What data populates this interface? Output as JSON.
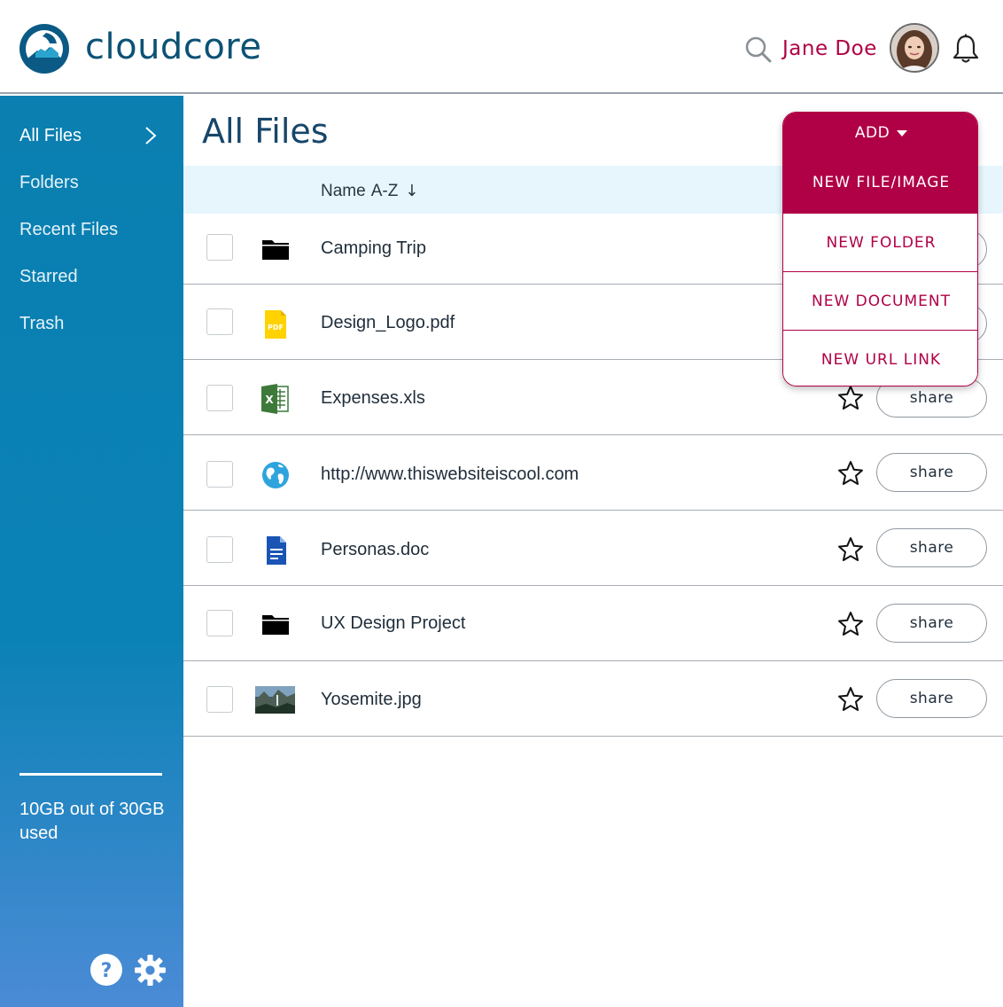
{
  "brand": {
    "name": "cloudcore",
    "logo_icon": "cloudcore-logo-icon"
  },
  "header": {
    "user_name": "Jane Doe",
    "accent_color": "#b00046"
  },
  "sidebar": {
    "items": [
      {
        "label": "All Files",
        "active": true
      },
      {
        "label": "Folders",
        "active": false
      },
      {
        "label": "Recent Files",
        "active": false
      },
      {
        "label": "Starred",
        "active": false
      },
      {
        "label": "Trash",
        "active": false
      }
    ],
    "storage_text": "10GB out of 30GB used",
    "background_color": "#0a7fb0"
  },
  "main": {
    "title": "All Files",
    "sort": {
      "label": "Name",
      "order": "A-Z",
      "arrow": "↓"
    },
    "files": [
      {
        "name": "Camping Trip",
        "icon": "folder-icon"
      },
      {
        "name": "Design_Logo.pdf",
        "icon": "pdf-icon",
        "icon_text": "PDF"
      },
      {
        "name": "Expenses.xls",
        "icon": "excel-icon",
        "icon_text": "X"
      },
      {
        "name": "http://www.thiswebsiteiscool.com",
        "icon": "globe-icon"
      },
      {
        "name": "Personas.doc",
        "icon": "document-icon"
      },
      {
        "name": "UX Design Project",
        "icon": "folder-icon"
      },
      {
        "name": "Yosemite.jpg",
        "icon": "image-thumbnail"
      }
    ],
    "share_label": "share"
  },
  "add_menu": {
    "label": "ADD",
    "items": [
      "NEW FILE/IMAGE",
      "NEW FOLDER",
      "NEW DOCUMENT",
      "NEW URL LINK"
    ]
  }
}
